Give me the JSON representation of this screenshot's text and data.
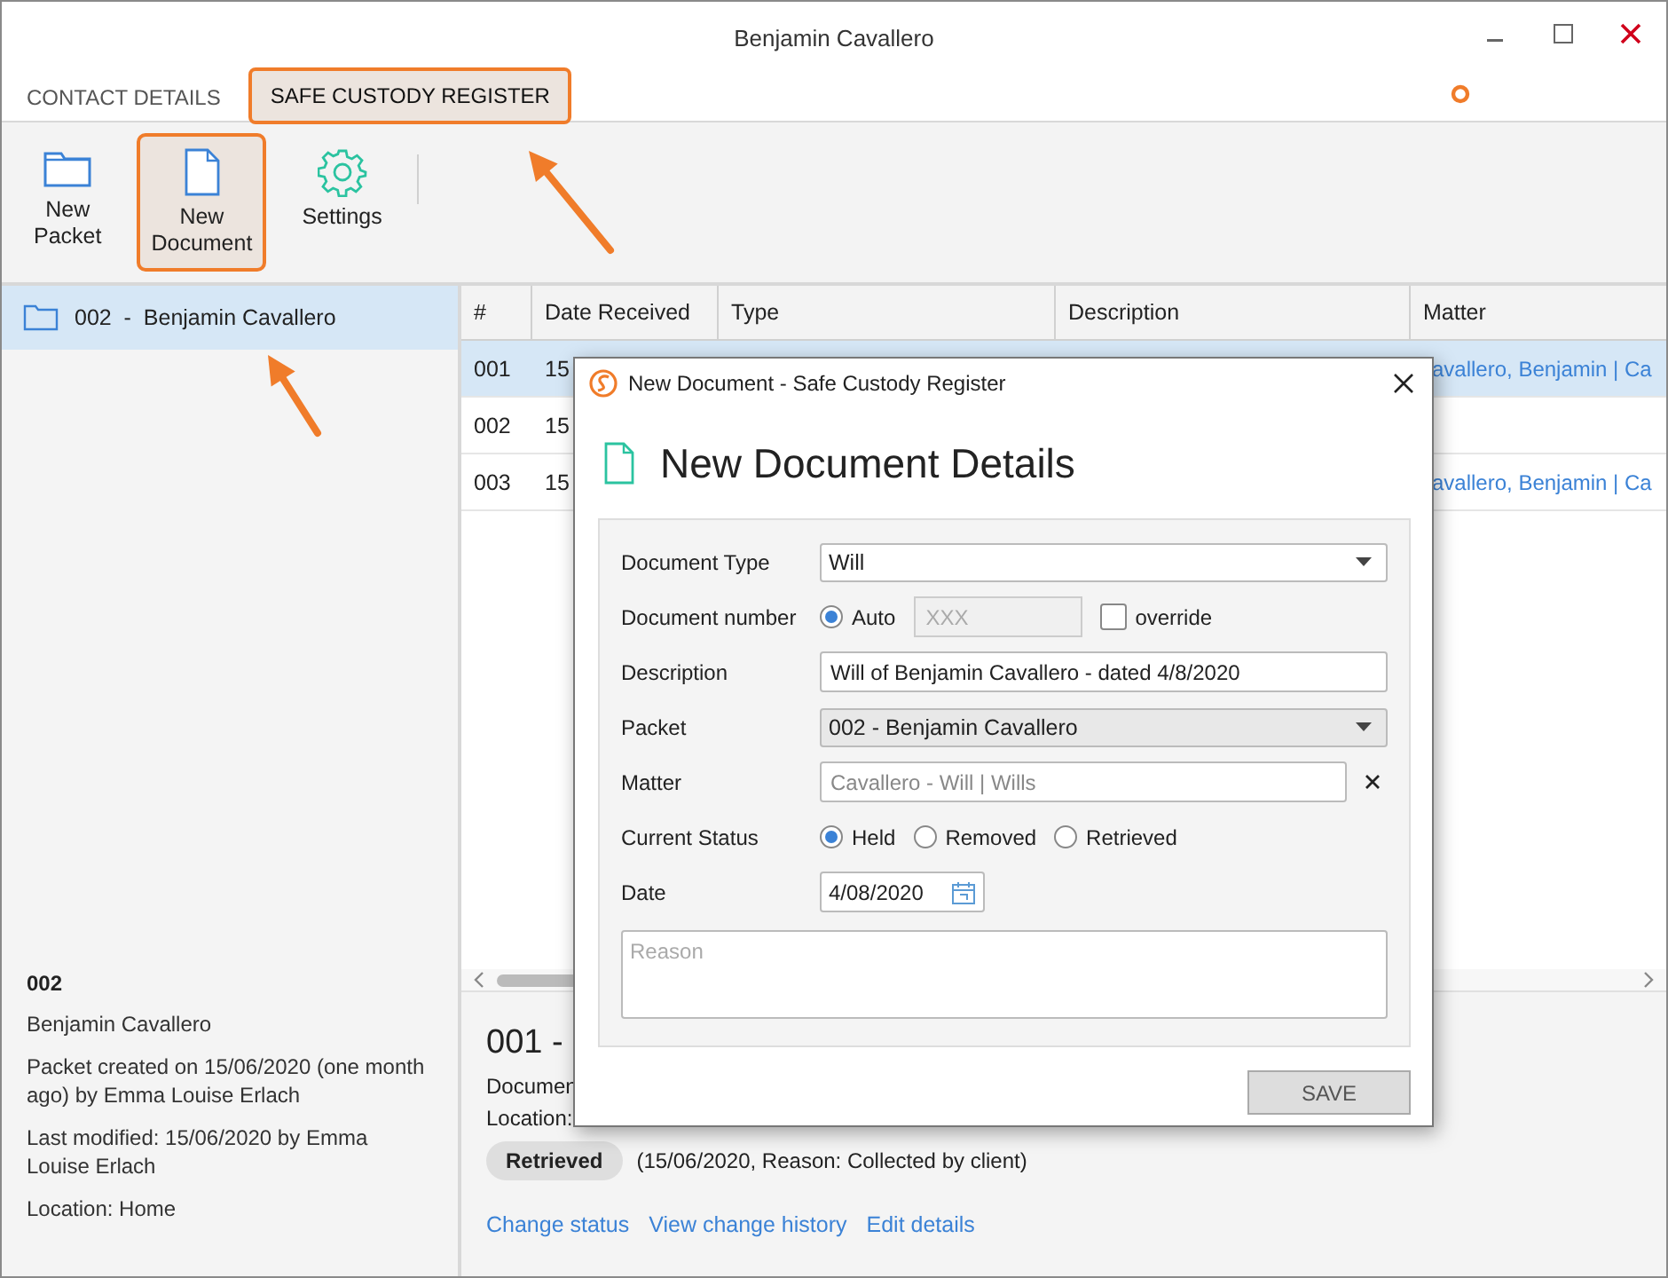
{
  "window": {
    "title": "Benjamin Cavallero"
  },
  "tabs": [
    {
      "label": "CONTACT DETAILS",
      "selected": false,
      "highlighted": false
    },
    {
      "label": "SAFE CUSTODY REGISTER",
      "selected": true,
      "highlighted": true
    }
  ],
  "ribbon": [
    {
      "label": "New Packet",
      "highlighted": false
    },
    {
      "label": "New Document",
      "highlighted": true
    },
    {
      "label": "Settings",
      "highlighted": false
    }
  ],
  "packets": [
    {
      "label": "002  -  Benjamin Cavallero",
      "selected": true
    }
  ],
  "packet_info": {
    "number": "002",
    "name": "Benjamin Cavallero",
    "created": "Packet created on 15/06/2020 (one month ago) by Emma Louise Erlach",
    "modified": "Last modified: 15/06/2020 by Emma Louise Erlach",
    "location": "Location: Home"
  },
  "table": {
    "columns": [
      "#",
      "Date Received",
      "Type",
      "Description",
      "Matter"
    ],
    "rows": [
      {
        "number": "001",
        "date": "15",
        "matter": "avallero, Benjamin | Ca",
        "selected": true
      },
      {
        "number": "002",
        "date": "15",
        "selected": false
      },
      {
        "number": "003",
        "date": "15",
        "matter": "avallero, Benjamin | Ca",
        "selected": false
      }
    ]
  },
  "detail": {
    "title": "001 -",
    "document": "Documen",
    "location": "Location:",
    "status": "Retrieved",
    "status_note": "(15/06/2020, Reason: Collected by client)",
    "links": [
      "Change status",
      "View change history",
      "Edit details"
    ]
  },
  "dialog": {
    "title": "New Document - Safe Custody Register",
    "heading": "New Document Details",
    "fields": [
      {
        "kind": "select",
        "label": "Document Type",
        "value": "Will",
        "disabled": false
      },
      {
        "kind": "number",
        "label": "Document number",
        "option": "Auto",
        "auto": true,
        "placeholder": "XXX",
        "override_label": "override",
        "override": false
      },
      {
        "kind": "text",
        "label": "Description",
        "value": "Will of Benjamin Cavallero - dated 4/8/2020"
      },
      {
        "kind": "select",
        "label": "Packet",
        "value": "002 - Benjamin Cavallero",
        "disabled": true
      },
      {
        "kind": "lookup",
        "label": "Matter",
        "placeholder": "Cavallero - Will | Wills"
      },
      {
        "kind": "radio",
        "label": "Current Status",
        "options": [
          {
            "label": "Held",
            "selected": true
          },
          {
            "label": "Removed",
            "selected": false
          },
          {
            "label": "Retrieved",
            "selected": false
          }
        ]
      },
      {
        "kind": "date",
        "label": "Date",
        "value": "4/08/2020"
      },
      {
        "kind": "textarea",
        "placeholder": "Reason"
      }
    ],
    "save": "SAVE",
    "save_disabled": true
  },
  "annotations": [
    {
      "kind": "arrow"
    },
    {
      "kind": "arrow"
    },
    {
      "kind": "dot"
    }
  ]
}
